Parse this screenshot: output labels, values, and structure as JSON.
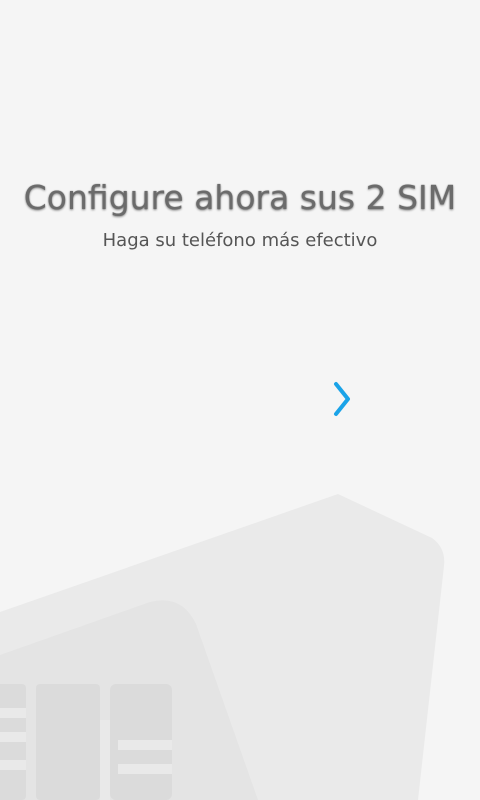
{
  "onboarding": {
    "title": "Configure ahora sus 2 SIM",
    "subtitle": "Haga su teléfono más efectivo",
    "next_icon": "chevron-right-icon",
    "illustration_icon": "sim-card-icon"
  },
  "colors": {
    "background": "#f5f5f5",
    "accent": "#1aa3e8",
    "title": "#6b6b6b",
    "subtitle": "#555555",
    "card_back": "#eaeaea",
    "card_front": "#e2e2e2",
    "chip": "#dcdcdc"
  }
}
